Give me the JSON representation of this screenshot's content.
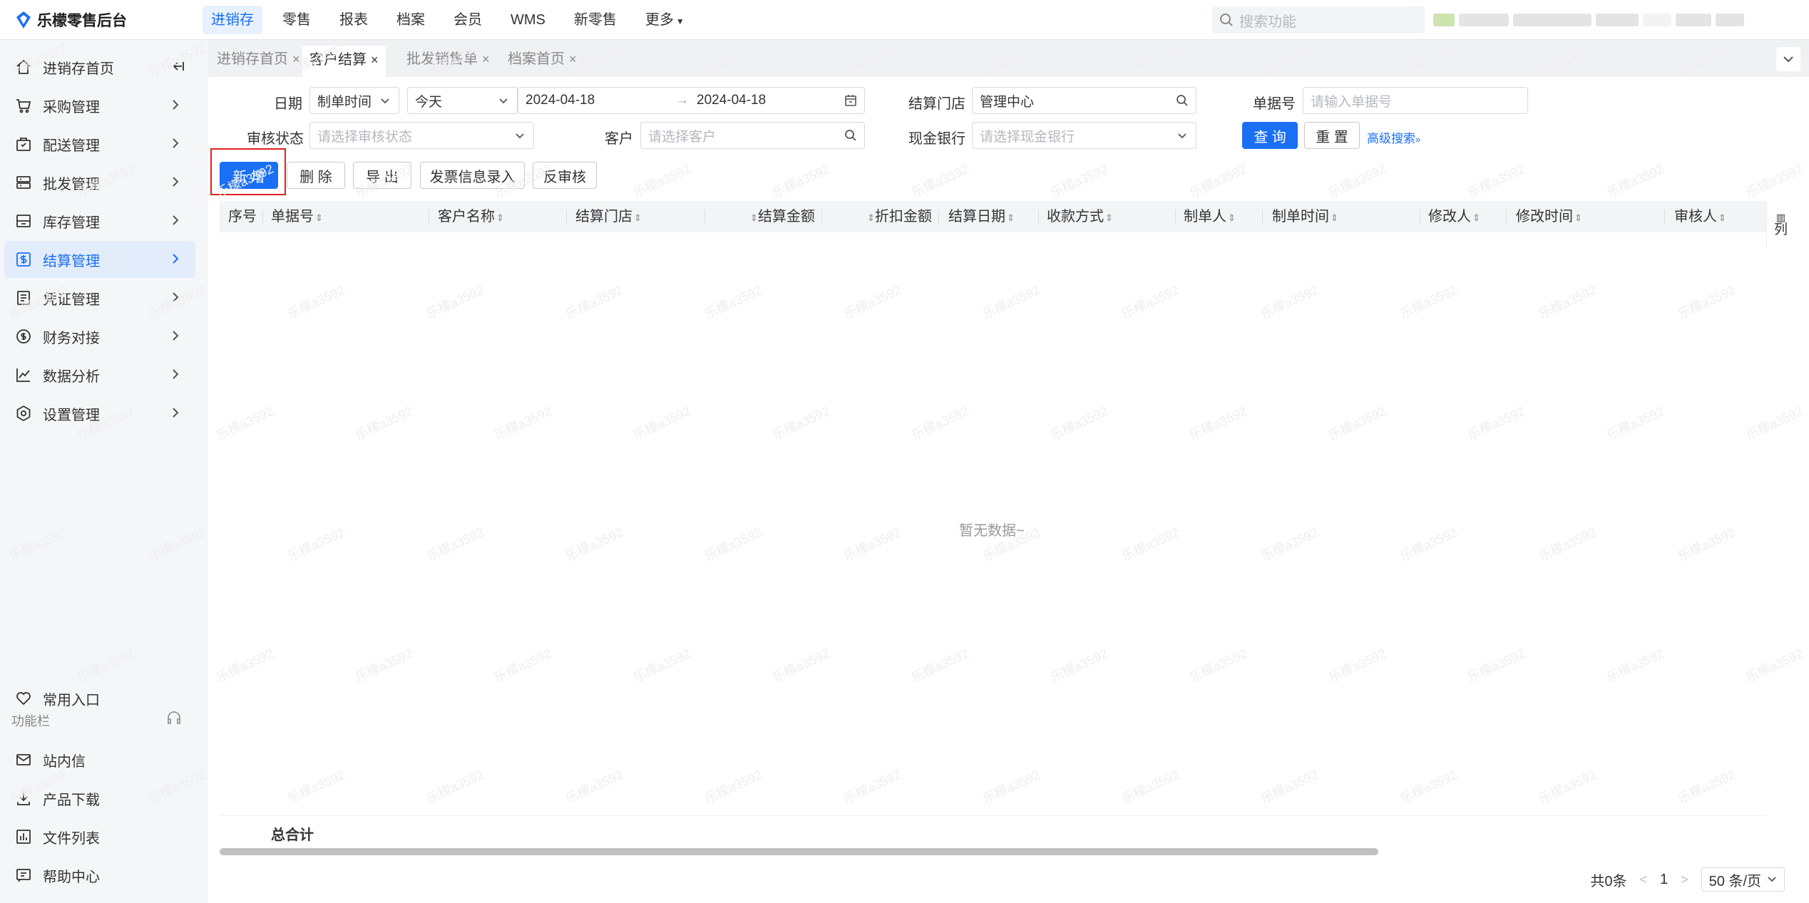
{
  "app": {
    "title": "乐檬零售后台"
  },
  "topnav": {
    "items": [
      "进销存",
      "零售",
      "报表",
      "档案",
      "会员",
      "WMS",
      "新零售"
    ],
    "more": "更多"
  },
  "search": {
    "placeholder": "搜索功能"
  },
  "sidebar": {
    "items": [
      {
        "label": "进销存首页"
      },
      {
        "label": "采购管理"
      },
      {
        "label": "配送管理"
      },
      {
        "label": "批发管理"
      },
      {
        "label": "库存管理"
      },
      {
        "label": "结算管理"
      },
      {
        "label": "凭证管理"
      },
      {
        "label": "财务对接"
      },
      {
        "label": "数据分析"
      },
      {
        "label": "设置管理"
      }
    ],
    "favorites": "常用入口",
    "function_bar": "功能栏",
    "bottom": [
      "站内信",
      "产品下载",
      "文件列表",
      "帮助中心"
    ]
  },
  "tabs": [
    "进销存首页",
    "客户结算",
    "批发销售单",
    "档案首页"
  ],
  "filters": {
    "date_label": "日期",
    "date_type": "制单时间",
    "date_range": "今天",
    "date_start": "2024-04-18",
    "date_end": "2024-04-18",
    "store_label": "结算门店",
    "store_value": "管理中心",
    "doc_no_label": "单据号",
    "doc_no_placeholder": "请输入单据号",
    "audit_label": "审核状态",
    "audit_placeholder": "请选择审核状态",
    "customer_label": "客户",
    "customer_placeholder": "请选择客户",
    "bank_label": "现金银行",
    "bank_placeholder": "请选择现金银行",
    "query": "查 询",
    "reset": "重 置",
    "advanced": "高级搜索"
  },
  "actions": {
    "add": "新 增",
    "delete": "删 除",
    "export": "导 出",
    "invoice": "发票信息录入",
    "unaudit": "反审核"
  },
  "table": {
    "columns": [
      "序号",
      "单据号",
      "客户名称",
      "结算门店",
      "结算金额",
      "折扣金额",
      "结算日期",
      "收款方式",
      "制单人",
      "制单时间",
      "修改人",
      "修改时间",
      "审核人"
    ],
    "column_toggle": "列",
    "empty": "暂无数据~",
    "total": "总合计"
  },
  "pagination": {
    "total": "共0条",
    "page": "1",
    "page_size": "50 条/页"
  },
  "watermark": "乐檬a3592"
}
